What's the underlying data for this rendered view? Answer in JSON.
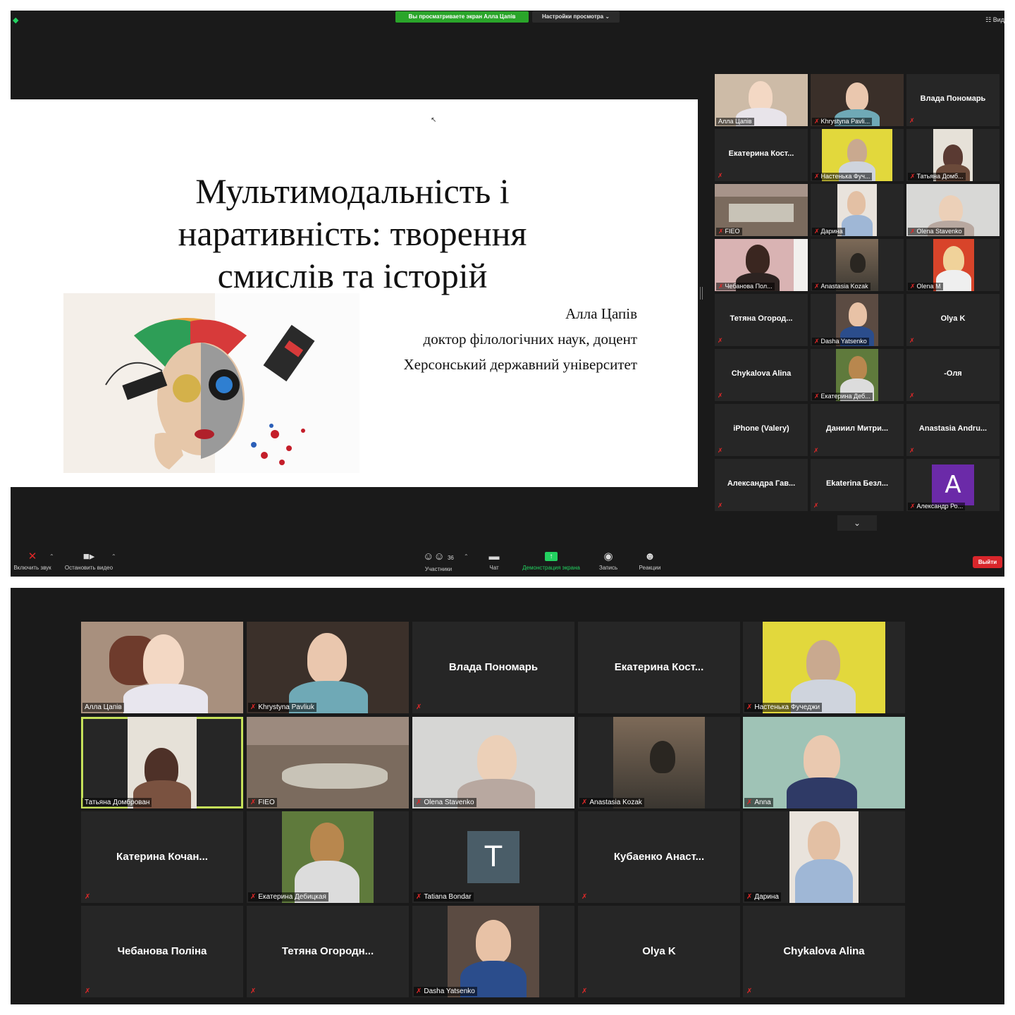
{
  "top": {
    "share_banner": "Вы просматриваете экран Алла Цапів",
    "view_options": "Настройки просмотра ⌄",
    "view_toggle": "☷ Вид",
    "slide": {
      "title_line1": "Мультимодальність і",
      "title_line2": "наративність: творення",
      "title_line3": "смислів та історій",
      "author": "Алла Цапів",
      "degree": "доктор філологічних наук, доцент",
      "university": "Херсонський державний університет"
    },
    "gallery": [
      {
        "label": "Алла Цапів",
        "video": true,
        "muted": false
      },
      {
        "label": "Khrystyna Pavli...",
        "video": true,
        "muted": true
      },
      {
        "name": "Влада Пономарь",
        "video": false,
        "muted": true
      },
      {
        "name": "Екатерина  Кост...",
        "video": false,
        "muted": true
      },
      {
        "label": "Настенька Фуч...",
        "video": true,
        "muted": true
      },
      {
        "label": "Татьяна Домб...",
        "video": true,
        "muted": true
      },
      {
        "label": "FIEO",
        "video": true,
        "muted": true
      },
      {
        "label": "Дарина",
        "video": true,
        "muted": true
      },
      {
        "label": "Olena Stavenko",
        "video": true,
        "muted": true
      },
      {
        "label": "Чебанова Пол...",
        "video": true,
        "muted": true
      },
      {
        "label": "Anastasia Kozak",
        "video": true,
        "muted": true
      },
      {
        "label": "Olena M",
        "video": true,
        "muted": true
      },
      {
        "name": "Тетяна  Огород...",
        "video": false,
        "muted": true
      },
      {
        "label": "Dasha Yatsenko",
        "video": true,
        "muted": true
      },
      {
        "name": "Olya K",
        "video": false,
        "muted": true
      },
      {
        "name": "Chykalova Alina",
        "video": false,
        "muted": true
      },
      {
        "label": "Екатерина Деб...",
        "video": true,
        "muted": true
      },
      {
        "name": "-Оля",
        "video": false,
        "muted": true
      },
      {
        "name": "iPhone (Valery)",
        "video": false,
        "muted": true
      },
      {
        "name": "Даниил  Митри...",
        "video": false,
        "muted": true
      },
      {
        "name": "Anastasia  Andru...",
        "video": false,
        "muted": true
      },
      {
        "name": "Александра  Гав...",
        "video": false,
        "muted": true
      },
      {
        "name": "Ekaterina  Безл...",
        "video": false,
        "muted": true
      },
      {
        "label": "Александр Ро...",
        "letter": "A",
        "muted": true
      }
    ],
    "toolbar": {
      "unmute": "Включить звук",
      "stop_video": "Остановить видео",
      "participants": "Участники",
      "participants_count": "36",
      "chat": "Чат",
      "share_screen": "Демонстрация экрана",
      "record": "Запись",
      "reactions": "Реакции",
      "leave": "Выйти"
    }
  },
  "bottom": {
    "tiles": [
      {
        "label": "Алла Цапів",
        "video": true,
        "muted": false
      },
      {
        "label": "Khrystyna Pavliuk",
        "video": true,
        "muted": true
      },
      {
        "name": "Влада Пономарь",
        "video": false,
        "muted": true
      },
      {
        "name": "Екатерина  Кост...",
        "video": false,
        "muted": false
      },
      {
        "label": "Настенька Фучеджи",
        "video": true,
        "muted": true
      },
      {
        "label": "Татьяна Домброван",
        "video": true,
        "muted": false
      },
      {
        "label": "FIEO",
        "video": true,
        "muted": true
      },
      {
        "label": "Olena Stavenko",
        "video": true,
        "muted": true
      },
      {
        "label": "Anastasia Kozak",
        "video": true,
        "muted": true
      },
      {
        "label": "Anna",
        "video": true,
        "muted": true
      },
      {
        "name": "Катерина  Кочан...",
        "video": false,
        "muted": true
      },
      {
        "label": "Екатерина Дебицкая",
        "video": true,
        "muted": true
      },
      {
        "label": "Tatiana Bondar",
        "letter": "T",
        "muted": true
      },
      {
        "name": "Кубаенко  Анаст...",
        "video": false,
        "muted": true
      },
      {
        "label": "Дарина",
        "video": true,
        "muted": true
      },
      {
        "name": "Чебанова Поліна",
        "video": false,
        "muted": true
      },
      {
        "name": "Тетяна  Огородн...",
        "video": false,
        "muted": true
      },
      {
        "label": "Dasha Yatsenko",
        "video": true,
        "muted": true
      },
      {
        "name": "Olya K",
        "video": false,
        "muted": true
      },
      {
        "name": "Chykalova Alina",
        "video": false,
        "muted": true
      }
    ]
  },
  "icons": {
    "mic_muted": "mic-muted-icon",
    "camera": "video-camera-icon",
    "participants": "participants-icon",
    "chat": "chat-bubble-icon",
    "share": "share-screen-icon",
    "record": "record-icon",
    "reactions": "reactions-icon",
    "shield": "security-shield-icon",
    "chevron": "chevron-down-icon"
  },
  "colors": {
    "accent_green": "#23d160",
    "active_speaker": "#c6e15a",
    "leave_red": "#d9262b",
    "background": "#1a1a1a",
    "tile": "#262626"
  }
}
